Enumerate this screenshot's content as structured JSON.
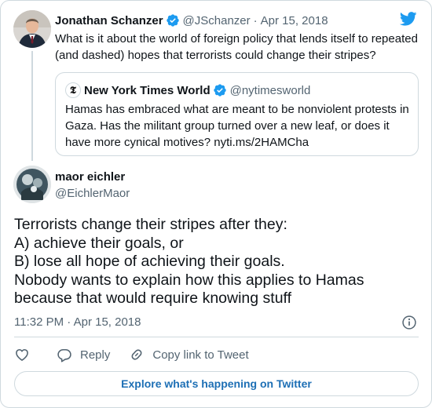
{
  "parent_tweet": {
    "author_name": "Jonathan Schanzer",
    "author_handle": "@JSchanzer",
    "separator": "·",
    "date": "Apr 15, 2018",
    "text": "What is it about the world of foreign policy that lends itself to repeated (and dashed) hopes that terrorists could change their stripes?",
    "verified": true
  },
  "quoted_tweet": {
    "author_name": "New York Times World",
    "author_handle": "@nytimesworld",
    "logo_glyph": "𝕿",
    "text": "Hamas has embraced what are meant to be nonviolent protests in Gaza. Has the militant group turned over a new leaf, or does it have more cynical motives? nyti.ms/2HAMCha",
    "verified": true
  },
  "main_tweet": {
    "author_name": "maor eichler",
    "author_handle": "@EichlerMaor",
    "lines": [
      "Terrorists change their stripes after they:",
      "A) achieve their goals, or",
      "B) lose all hope of achieving their goals.",
      "Nobody wants to explain how this applies to Hamas",
      "because that would require knowing stuff"
    ],
    "timestamp": "11:32 PM · Apr 15, 2018"
  },
  "actions": {
    "reply_label": "Reply",
    "copy_label": "Copy link to Tweet"
  },
  "footer": {
    "explore_label": "Explore what's happening on Twitter"
  },
  "colors": {
    "brand_blue": "#1d9bf0",
    "link_blue": "#1d6fb5",
    "muted": "#536471",
    "border": "#cfd9de"
  },
  "icons": [
    "twitter-logo-icon",
    "verified-badge-icon",
    "info-icon",
    "heart-icon",
    "reply-icon",
    "link-icon"
  ]
}
